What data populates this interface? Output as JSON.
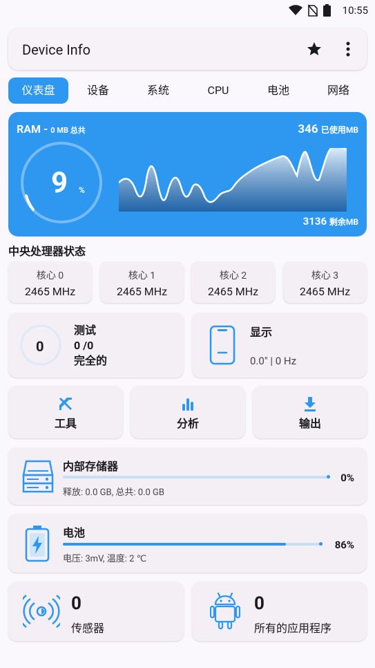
{
  "status_bar": {
    "time": "10:55"
  },
  "app_bar": {
    "title": "Device Info"
  },
  "tabs": [
    "仪表盘",
    "设备",
    "系统",
    "CPU",
    "电池",
    "网络"
  ],
  "ram": {
    "label": "RAM - ",
    "total_label": "0 MB 总共",
    "used_value": "346",
    "used_unit": "已使用MB",
    "free_value": "3136",
    "free_unit": "剩余MB",
    "percent": "9",
    "percent_sign": "%"
  },
  "cpu_section": {
    "title": "中央处理器状态",
    "cores": [
      {
        "name": "核心 0",
        "freq": "2465 MHz"
      },
      {
        "name": "核心 1",
        "freq": "2465 MHz"
      },
      {
        "name": "核心 2",
        "freq": "2465 MHz"
      },
      {
        "name": "核心 3",
        "freq": "2465 MHz"
      }
    ]
  },
  "test": {
    "count": "0",
    "title": "测试",
    "progress": "0 /0",
    "status": "完全的"
  },
  "display": {
    "title": "显示",
    "value": "0.0\" | 0 Hz"
  },
  "tools": [
    {
      "label": "工具",
      "icon": "tools-icon"
    },
    {
      "label": "分析",
      "icon": "analytics-icon"
    },
    {
      "label": "输出",
      "icon": "download-icon"
    }
  ],
  "storage": {
    "title": "内部存储器",
    "percent": "0%",
    "fill": 0,
    "detail": "释放: 0.0 GB,  总共: 0.0 GB"
  },
  "battery": {
    "title": "电池",
    "percent": "86%",
    "fill": 0.86,
    "detail": "电压: 3mV,  温度: 2 ℃"
  },
  "sensors": {
    "count": "0",
    "label": "传感器"
  },
  "apps": {
    "count": "0",
    "label": "所有的应用程序"
  },
  "colors": {
    "accent": "#2e97f0",
    "background": "#fbf8fd",
    "card": "#f3eff5"
  }
}
